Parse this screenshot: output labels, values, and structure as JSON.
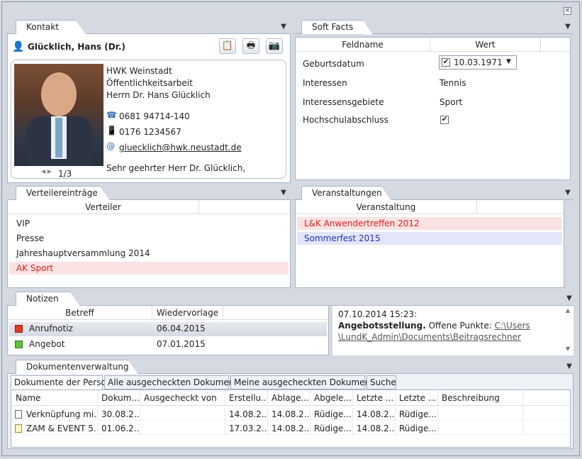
{
  "kontakt": {
    "tab_label": "Kontakt",
    "name": "Glücklich, Hans (Dr.)",
    "address_lines": [
      "HWK Weinstadt",
      "Öffentlichkeitsarbeit",
      "Herrn Dr. Hans Glücklich"
    ],
    "phone": "0681 94714-140",
    "mobile": "0176 1234567",
    "email": "gluecklich@hwk.neustadt.de",
    "salutation": "Sehr geehrter Herr Dr. Glücklich,",
    "photo_pager": "1/3"
  },
  "softfacts": {
    "tab_label": "Soft Facts",
    "col_field": "Feldname",
    "col_value": "Wert",
    "rows": [
      {
        "field": "Geburtsdatum",
        "value": "10.03.1971"
      },
      {
        "field": "Interessen",
        "value": "Tennis"
      },
      {
        "field": "Interessensgebiete",
        "value": "Sport"
      },
      {
        "field": "Hochschulabschluss",
        "value": ""
      }
    ]
  },
  "verteiler": {
    "tab_label": "Verteilereinträge",
    "col": "Verteiler",
    "rows": [
      "VIP",
      "Presse",
      "Jahreshauptversammlung 2014",
      "AK Sport"
    ]
  },
  "veranstaltungen": {
    "tab_label": "Veranstaltungen",
    "col": "Veranstaltung",
    "rows": [
      "L&K Anwendertreffen 2012",
      "Sommerfest 2015"
    ]
  },
  "notizen": {
    "tab_label": "Notizen",
    "col_subject": "Betreff",
    "col_followup": "Wiedervorlage",
    "rows": [
      {
        "subject": "Anrufnotiz",
        "date": "06.04.2015"
      },
      {
        "subject": "Angebot",
        "date": "07.01.2015"
      }
    ],
    "detail_timestamp": "07.10.2014 15:23:",
    "detail_bold": "Angebotsstellung.",
    "detail_text": " Offene Punkte: ",
    "detail_link1": "C:\\Users",
    "detail_link2": "\\LundK_Admin\\Documents\\Beitragsrechner"
  },
  "dokumente": {
    "tab_label": "Dokumentenverwaltung",
    "subtabs": [
      "Dokumente der Person",
      "Alle ausgecheckten Dokumente",
      "Meine ausgecheckten Dokumente",
      "Suche"
    ],
    "columns": [
      "Name",
      "Dokum...",
      "Ausgecheckt von",
      "Erstellu...",
      "Ablage...",
      "Abgele...",
      "Letzte ...",
      "Letzte ...",
      "Beschreibung"
    ],
    "rows": [
      [
        "Verknüpfung mi...",
        "30.08.2...",
        "",
        "14.08.2...",
        "14.08.2...",
        "Rüdige...",
        "14.08.2...",
        "Rüdige...",
        ""
      ],
      [
        "ZAM & EVENT 5...",
        "01.06.2...",
        "",
        "17.03.2...",
        "14.08.2...",
        "Rüdige...",
        "14.08.2...",
        "Rüdige...",
        ""
      ]
    ]
  }
}
